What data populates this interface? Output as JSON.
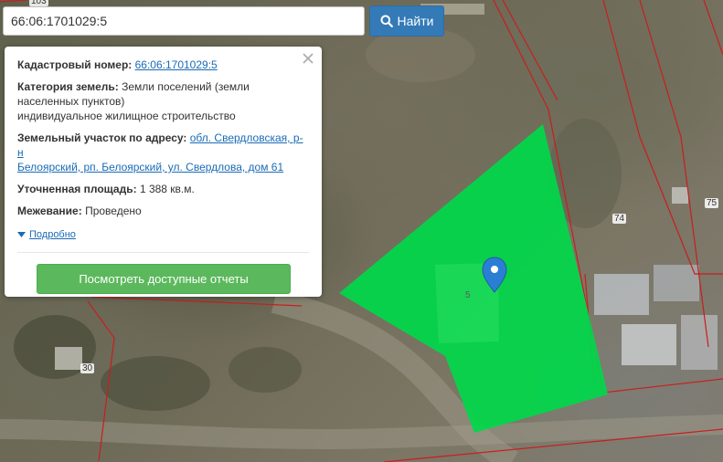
{
  "search": {
    "value": "66:06:1701029:5",
    "button_label": "Найти",
    "button_icon": "search-icon"
  },
  "popup": {
    "cadastral_label": "Кадастровый номер:",
    "cadastral_value": "66:06:1701029:5",
    "category_label": "Категория земель:",
    "category_value_line1": "Земли поселений (земли",
    "category_value_line2": "населенных пунктов)",
    "category_value_line3": "индивидуальное жилищное строительство",
    "address_label": "Земельный участок по адресу:",
    "address_value_line1": "обл. Свердловская, р-н",
    "address_value_line2": "Белоярский, рп. Белоярский, ул. Свердлова, дом 61",
    "area_label": "Уточненная площадь:",
    "area_value": "1 388 кв.м.",
    "survey_label": "Межевание:",
    "survey_value": "Проведено",
    "details_link": "Подробно",
    "report_button": "Посмотреть доступные отчеты",
    "close_icon": "close-icon"
  },
  "map": {
    "plot_label": "5",
    "neighbor_labels": [
      "74",
      "75",
      "30",
      "103"
    ],
    "highlight_color": "#00d84a",
    "boundary_color": "#c81e1e",
    "marker_color": "#2a7fd4"
  }
}
